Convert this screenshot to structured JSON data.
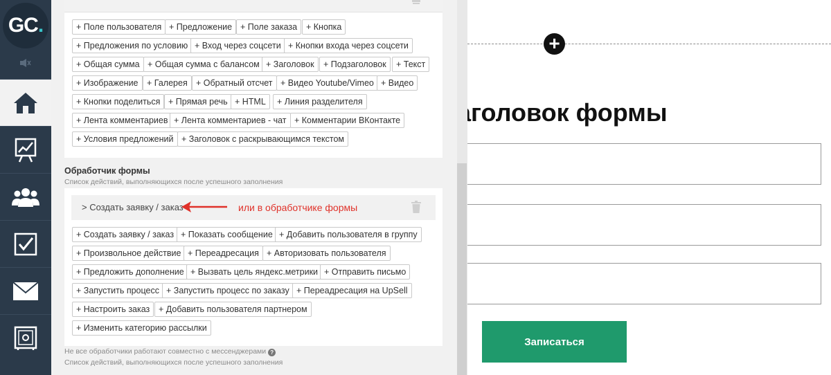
{
  "nav": {
    "logo": "GC",
    "logo_dot": ".",
    "items": [
      {
        "name": "home-icon",
        "active": true
      },
      {
        "name": "chart-icon"
      },
      {
        "name": "users-icon"
      },
      {
        "name": "checkbox-icon"
      },
      {
        "name": "mail-icon"
      },
      {
        "name": "safe-icon"
      }
    ]
  },
  "elements_block": {
    "chips": [
      "+ Поле пользователя",
      "+ Предложение",
      "+ Поле заказа",
      "+ Кнопка",
      "+ Предложения по условию",
      "+ Вход через соцсети",
      "+ Кнопки входа через соцсети",
      "+ Общая сумма",
      "+ Общая сумма с балансом",
      "+ Заголовок",
      "+ Подзаголовок",
      "+ Текст",
      "+ Изображение",
      "+ Галерея",
      "+ Обратный отсчет",
      "+ Видео Youtube/Vimeo",
      "+ Видео",
      "+ Кнопки поделиться",
      "+ Прямая речь",
      "+ HTML",
      "+ Линия разделителя",
      "+ Лента комментариев",
      "+ Лента комментариев - чат",
      "+ Комментарии ВКонтакте",
      "+ Условия предложений",
      "+ Заголовок с раскрывающимся текстом"
    ]
  },
  "handler": {
    "title": "Обработчик формы",
    "subtitle": "Список действий, выполняющихся после успешного заполнения",
    "current_action": "> Создать заявку / заказ",
    "annotation": "или в обработчике формы",
    "chips": [
      "+ Создать заявку / заказ",
      "+ Показать сообщение",
      "+ Добавить пользователя в группу",
      "+ Произвольное действие",
      "+ Переадресация",
      "+ Авторизовать пользователя",
      "+ Предложить дополнение",
      "+ Вызвать цель яндекс.метрики",
      "+ Отправить письмо",
      "+ Запустить процесс",
      "+ Запустить процесс по заказу",
      "+ Переадресация на UpSell",
      "+ Настроить заказ",
      "+ Добавить пользователя партнером",
      "+ Изменить категорию рассылки"
    ],
    "note": "Не все обработчики работают совместно с мессенджерами",
    "note2": "Список действий, выполняющихся после успешного заполнения"
  },
  "canvas": {
    "plus": "+",
    "form_title": "аголовок формы",
    "submit_label": "Записаться"
  },
  "colors": {
    "nav_bg": "#2b3a4a",
    "accent_teal": "#39c3c8",
    "annotation_red": "#e0322a",
    "submit_green": "#1f9a6c"
  }
}
